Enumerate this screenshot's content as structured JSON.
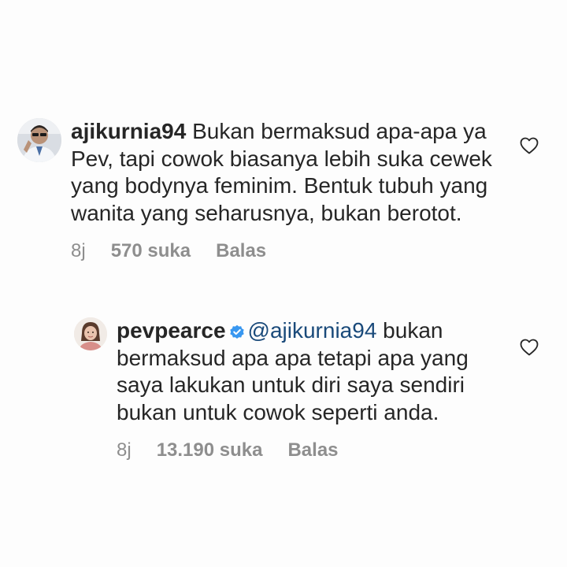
{
  "comments": [
    {
      "username": "ajikurnia94",
      "text": "Bukan bermaksud apa-apa ya Pev, tapi cowok biasanya lebih suka cewek yang bodynya feminim. Bentuk tubuh yang wanita yang seharusnya, bukan berotot.",
      "time": "8j",
      "likes": "570 suka",
      "reply_label": "Balas",
      "verified": false,
      "icons": {
        "like": "heart-outline-icon"
      }
    },
    {
      "username": "pevpearce",
      "mention": "@ajikurnia94",
      "text": "bukan bermaksud apa apa tetapi apa yang saya lakukan untuk diri saya sendiri bukan untuk cowok seperti anda.",
      "time": "8j",
      "likes": "13.190 suka",
      "reply_label": "Balas",
      "verified": true,
      "icons": {
        "verified": "verified-badge-icon",
        "like": "heart-outline-icon"
      }
    }
  ],
  "colors": {
    "text": "#262626",
    "meta": "#8e8e8e",
    "mention": "#1a4a7a",
    "verified": "#3897f0"
  }
}
